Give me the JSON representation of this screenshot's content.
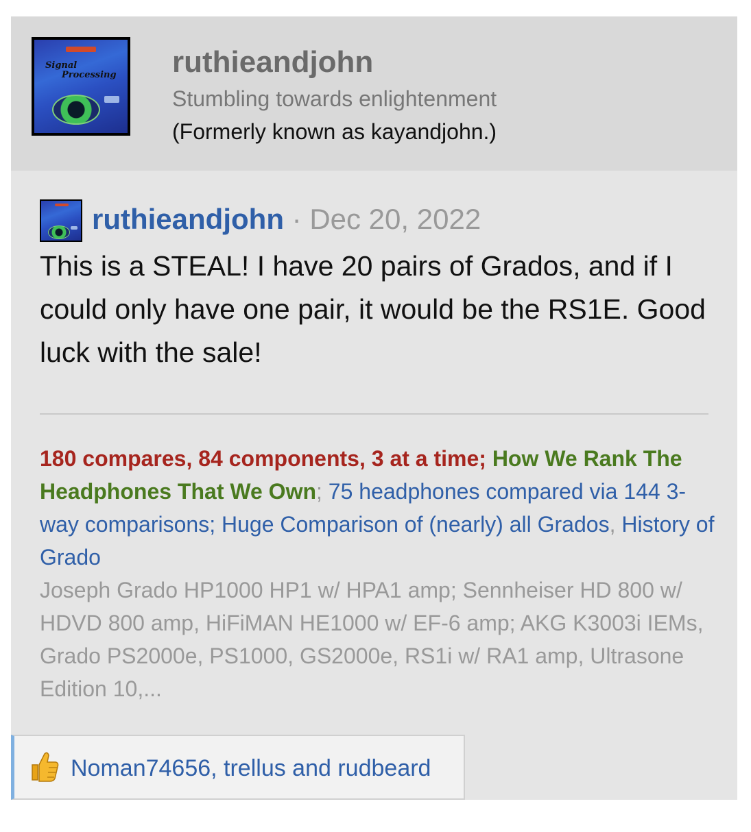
{
  "profile": {
    "username": "ruthieandjohn",
    "tagline": "Stumbling towards enlightenment",
    "formerly": "(Formerly known as kayandjohn.)",
    "avatar_icon": "signal-processing-book-cover-avatar",
    "avatar_text": [
      "Signal",
      "Processing"
    ]
  },
  "post": {
    "author": "ruthieandjohn",
    "separator": "·",
    "date": "Dec 20, 2022",
    "body": "This is a STEAL! I have 20 pairs of Grados, and if I could only have one pair, it would be the RS1E. Good luck with the sale!"
  },
  "signature": {
    "compares": "180 compares, 84 components, 3 at a time;",
    "how_we_rank": "How We Rank The Headphones That We Own",
    "sep1": ";",
    "headphones_compared": "75 headphones compared via 144 3-way comparisons;",
    "huge_comparison": "Huge Comparison of (nearly) all Grados",
    "sep2": ",",
    "history": "History of Grado",
    "gear": "Joseph Grado HP1000 HP1 w/ HPA1 amp; Sennheiser HD 800 w/ HDVD 800 amp, HiFiMAN HE1000 w/ EF-6 amp; AKG K3003i IEMs, Grado PS2000e, PS1000, GS2000e, RS1i w/ RA1 amp, Ultrasone Edition 10,..."
  },
  "reactions": {
    "icon": "thumbs-up-icon",
    "text": "Noman74656, trellus and rudbeard"
  },
  "colors": {
    "link_blue": "#2f5fa8",
    "sig_red": "#a6251e",
    "sig_green": "#4a7a1f",
    "muted_gray": "#999999",
    "card_bg": "#e5e5e5",
    "header_bg": "#d9d9d9"
  }
}
